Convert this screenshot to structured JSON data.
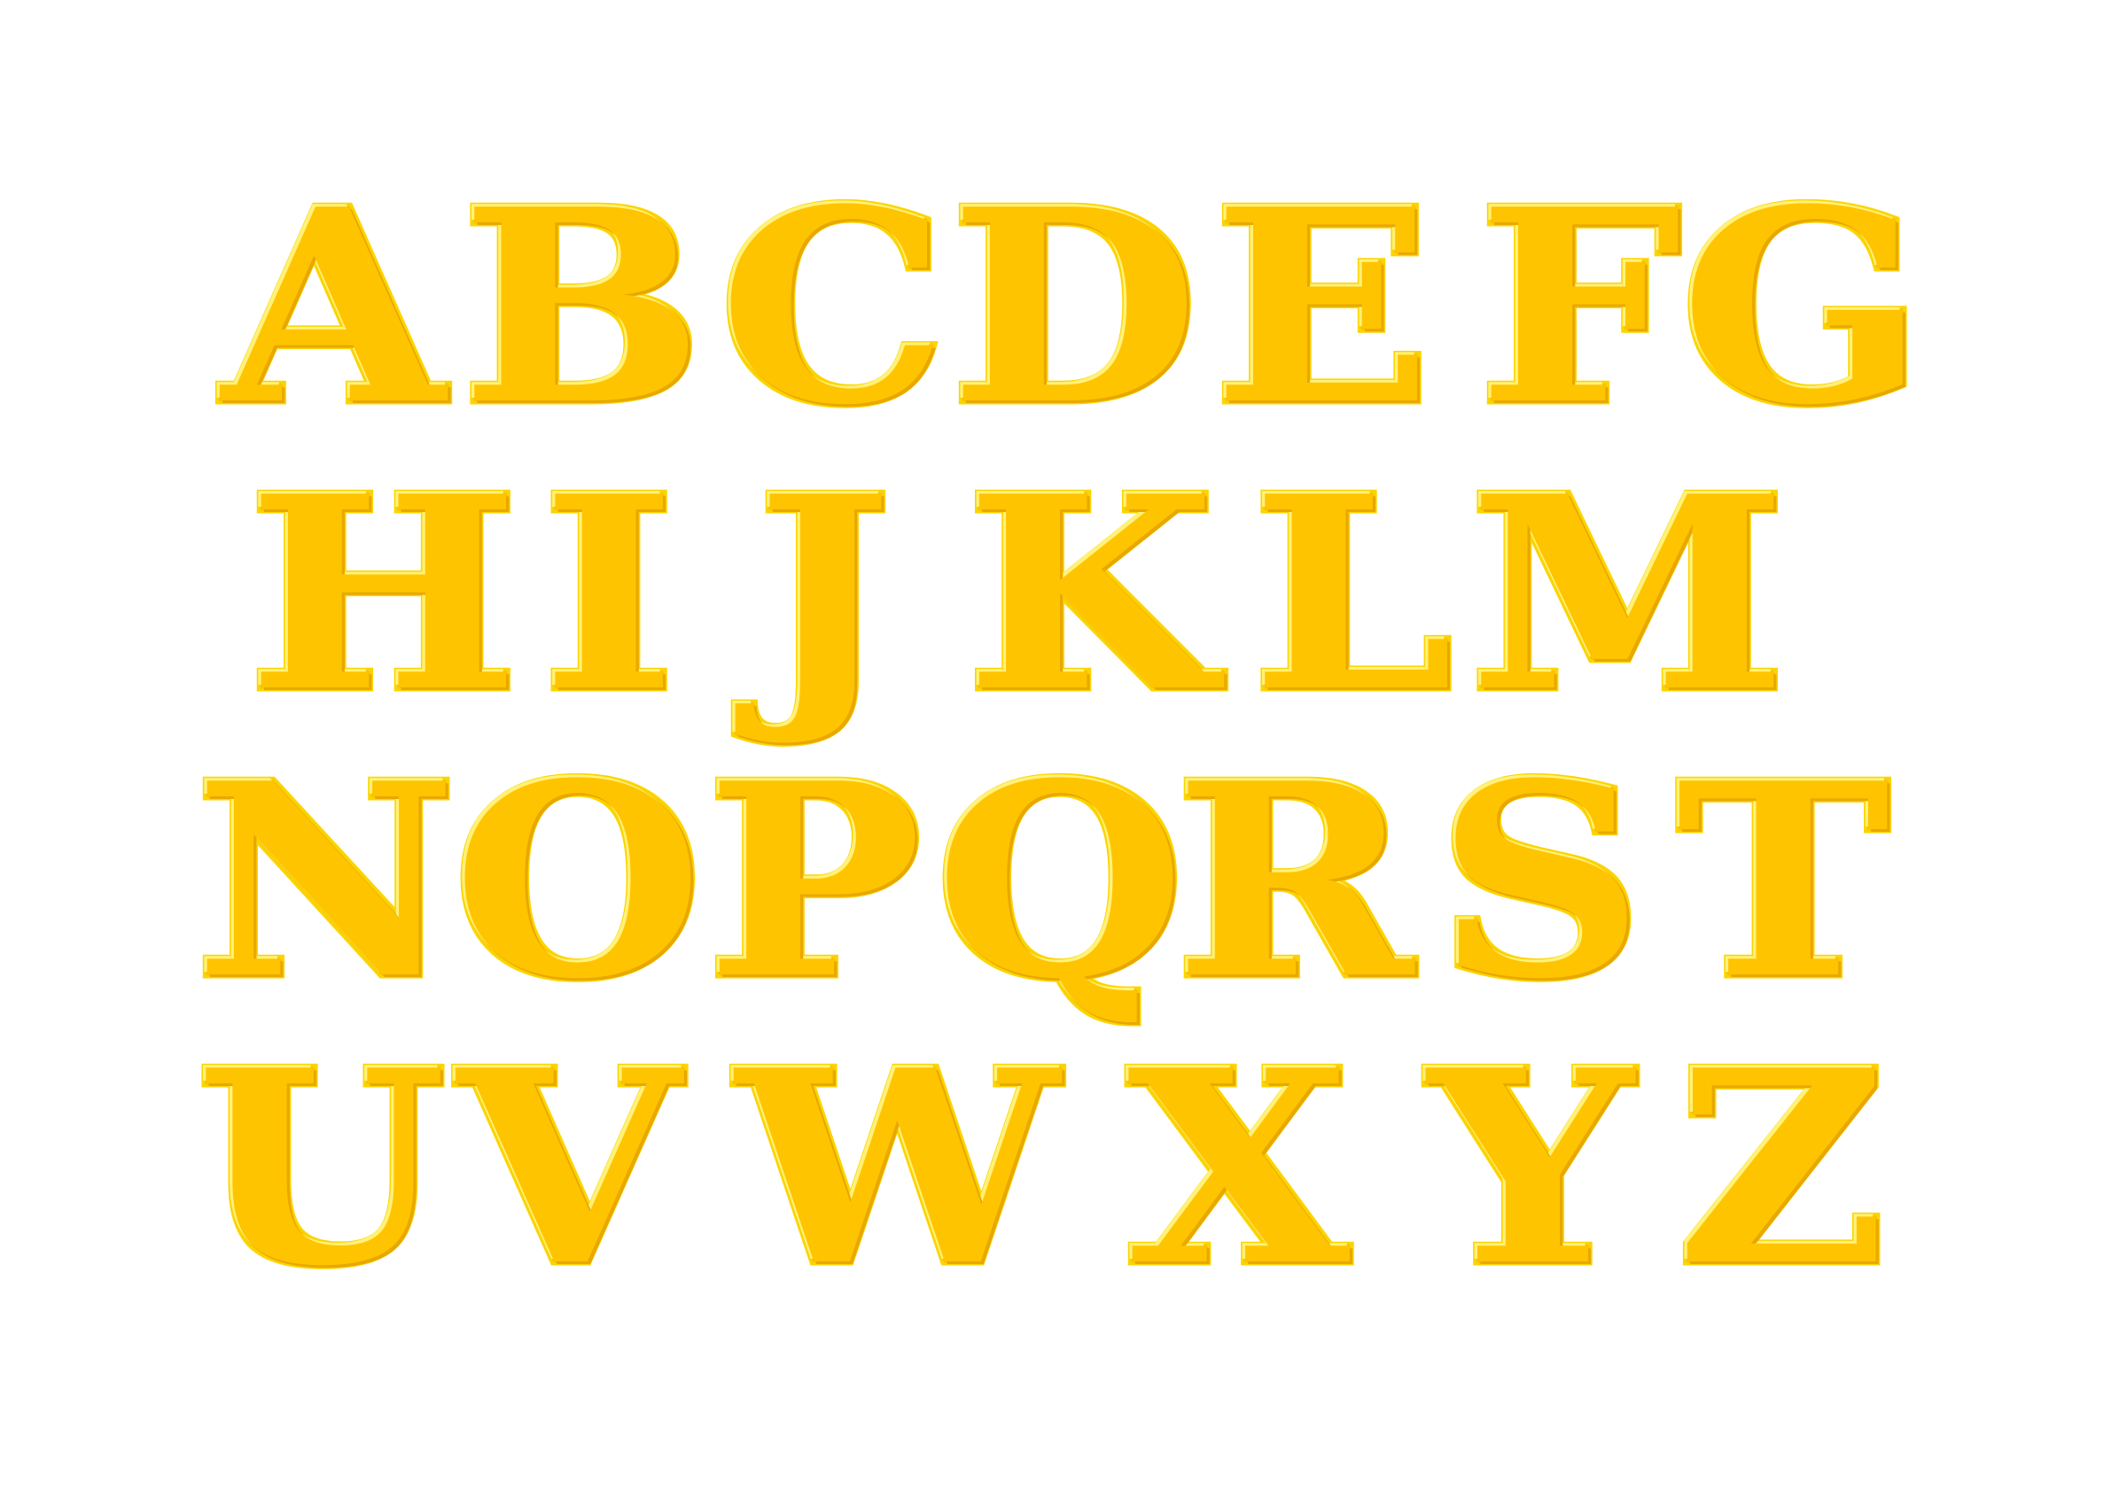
{
  "colors": {
    "background": "#ffffff",
    "letter_fill": "#ffc400",
    "letter_outline": "#fcd400",
    "letter_shadow": "#e8a800",
    "letter_highlight": "#fff27a"
  },
  "alphabet": {
    "rows": [
      [
        "A",
        "B",
        "C",
        "D",
        "E",
        "F",
        "G"
      ],
      [
        "H",
        "I",
        "J",
        "K",
        "L",
        "M"
      ],
      [
        "N",
        "O",
        "P",
        "Q",
        "R",
        "S",
        "T"
      ],
      [
        "U",
        "V",
        "W",
        "X",
        "Y",
        "Z"
      ]
    ]
  }
}
